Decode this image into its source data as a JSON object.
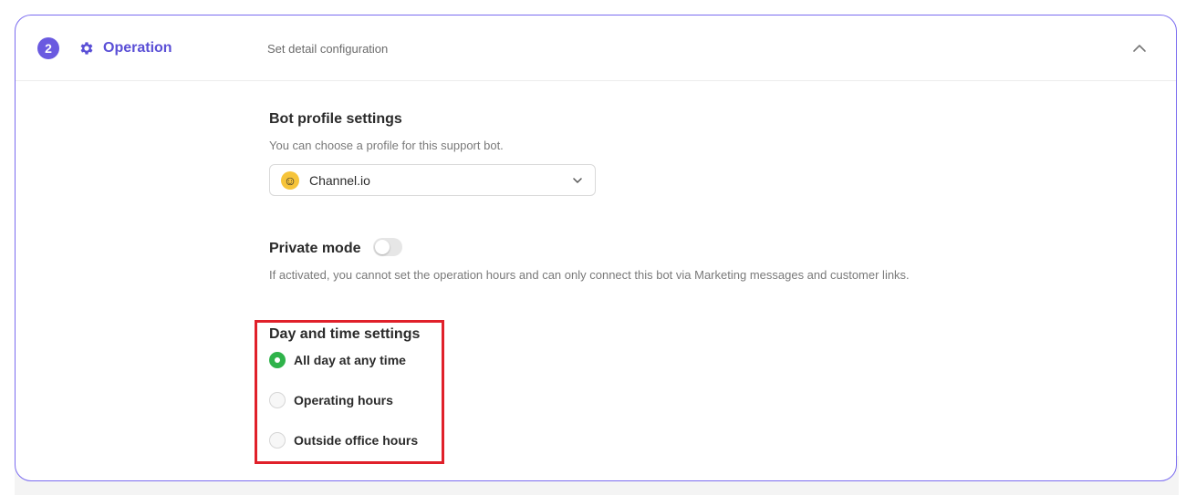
{
  "header": {
    "step_number": "2",
    "title": "Operation",
    "description": "Set detail configuration"
  },
  "bot_profile": {
    "heading": "Bot profile settings",
    "helper": "You can choose a profile for this support bot.",
    "selected_value": "Channel.io",
    "emoji": "☺"
  },
  "private_mode": {
    "heading": "Private mode",
    "enabled": false,
    "helper": "If activated, you cannot set the operation hours and can only connect this bot via Marketing messages and customer links."
  },
  "day_time": {
    "heading": "Day and time settings",
    "options": [
      {
        "label": "All day at any time",
        "selected": true
      },
      {
        "label": "Operating hours",
        "selected": false
      },
      {
        "label": "Outside office hours",
        "selected": false
      }
    ]
  },
  "colors": {
    "accent": "#6a5ae0",
    "radio_selected": "#2fb34a",
    "highlight": "#e0202a"
  }
}
